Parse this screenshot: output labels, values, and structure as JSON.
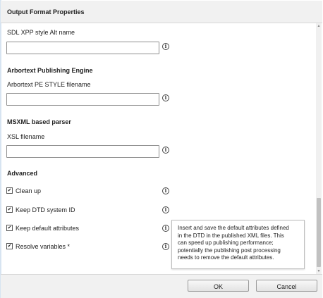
{
  "dialog": {
    "title": "Output Format Properties"
  },
  "fields": {
    "sdl_alt_name": {
      "label": "SDL XPP style Alt name",
      "value": ""
    },
    "arbortext_section": "Arbortext Publishing Engine",
    "arbortext_pe_style": {
      "label": "Arbortext PE STYLE filename",
      "value": ""
    },
    "msxml_section": "MSXML based parser",
    "xsl_filename": {
      "label": "XSL filename",
      "value": ""
    }
  },
  "advanced": {
    "section": "Advanced",
    "options": [
      {
        "label": "Clean up",
        "checked": true
      },
      {
        "label": "Keep DTD system ID",
        "checked": true
      },
      {
        "label": "Keep default attributes",
        "checked": true
      },
      {
        "label": "Resolve variables *",
        "checked": true
      }
    ]
  },
  "tooltip": {
    "lines": [
      "Insert and save the default attributes defined",
      "in the DTD in the published XML files. This",
      "can speed up publishing performance;",
      "potentially the publishing post processing",
      "needs to remove the default attributes."
    ]
  },
  "footer": {
    "ok_label": "OK",
    "cancel_label": "Cancel"
  },
  "icons": {
    "info": "info-circle-icon",
    "check": "checkmark-icon"
  }
}
